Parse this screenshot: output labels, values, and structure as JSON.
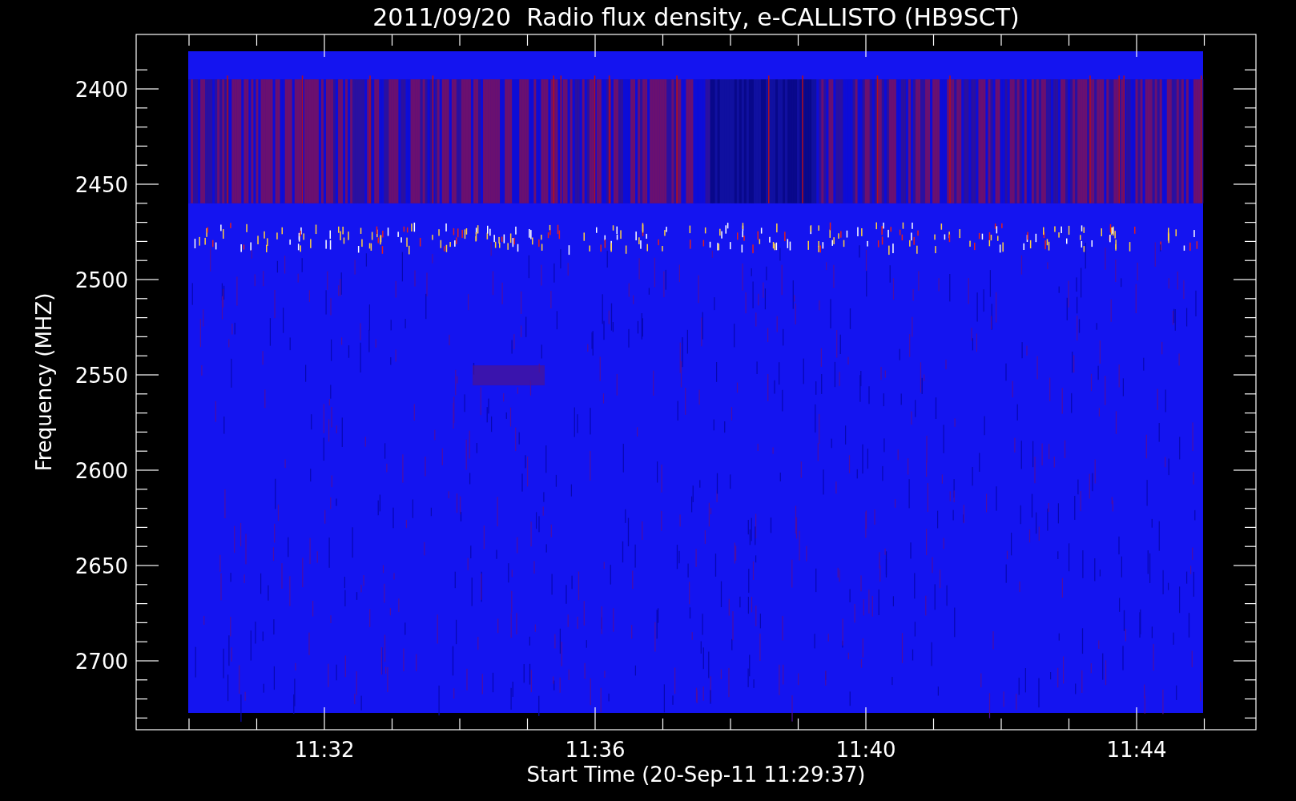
{
  "plot": {
    "title": "2011/09/20  Radio flux density, e-CALLISTO (HB9SCT)",
    "xlabel": "Start Time (20-Sep-11 11:29:37)",
    "ylabel": "Frequency (MHZ)",
    "yticks": [
      "2400",
      "2450",
      "2500",
      "2550",
      "2600",
      "2650",
      "2700"
    ],
    "xticks": [
      "11:32",
      "11:36",
      "11:40",
      "11:44"
    ]
  }
}
